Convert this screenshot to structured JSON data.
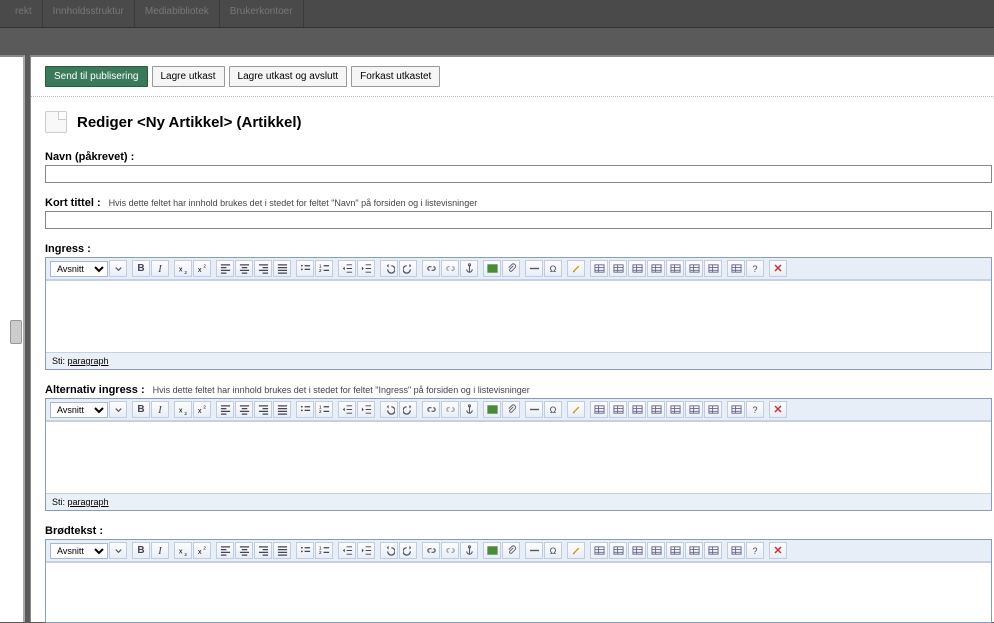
{
  "topTabs": [
    "rekt",
    "Innholdsstruktur",
    "Mediabibliotek",
    "Brukerkontoer"
  ],
  "actions": {
    "publish": "Send til publisering",
    "save": "Lagre utkast",
    "saveExit": "Lagre utkast og avslutt",
    "discard": "Forkast utkastet"
  },
  "header": {
    "title": "Rediger <Ny Artikkel> (Artikkel)"
  },
  "fields": {
    "name": {
      "label": "Navn (påkrevet) :",
      "value": ""
    },
    "shortTitle": {
      "label": "Kort tittel :",
      "hint": "Hvis dette feltet har innhold brukes det i stedet for feltet \"Navn\" på forsiden og i listevisninger",
      "value": ""
    },
    "ingress": {
      "label": "Ingress :"
    },
    "altIngress": {
      "label": "Alternativ ingress :",
      "hint": "Hvis dette feltet har innhold brukes det i stedet for feltet \"Ingress\" på forsiden og i listevisninger"
    },
    "body": {
      "label": "Brødtekst :"
    }
  },
  "editor": {
    "formatSelect": "Avsnitt",
    "pathLabel": "Sti:",
    "pathValue": "paragraph"
  }
}
